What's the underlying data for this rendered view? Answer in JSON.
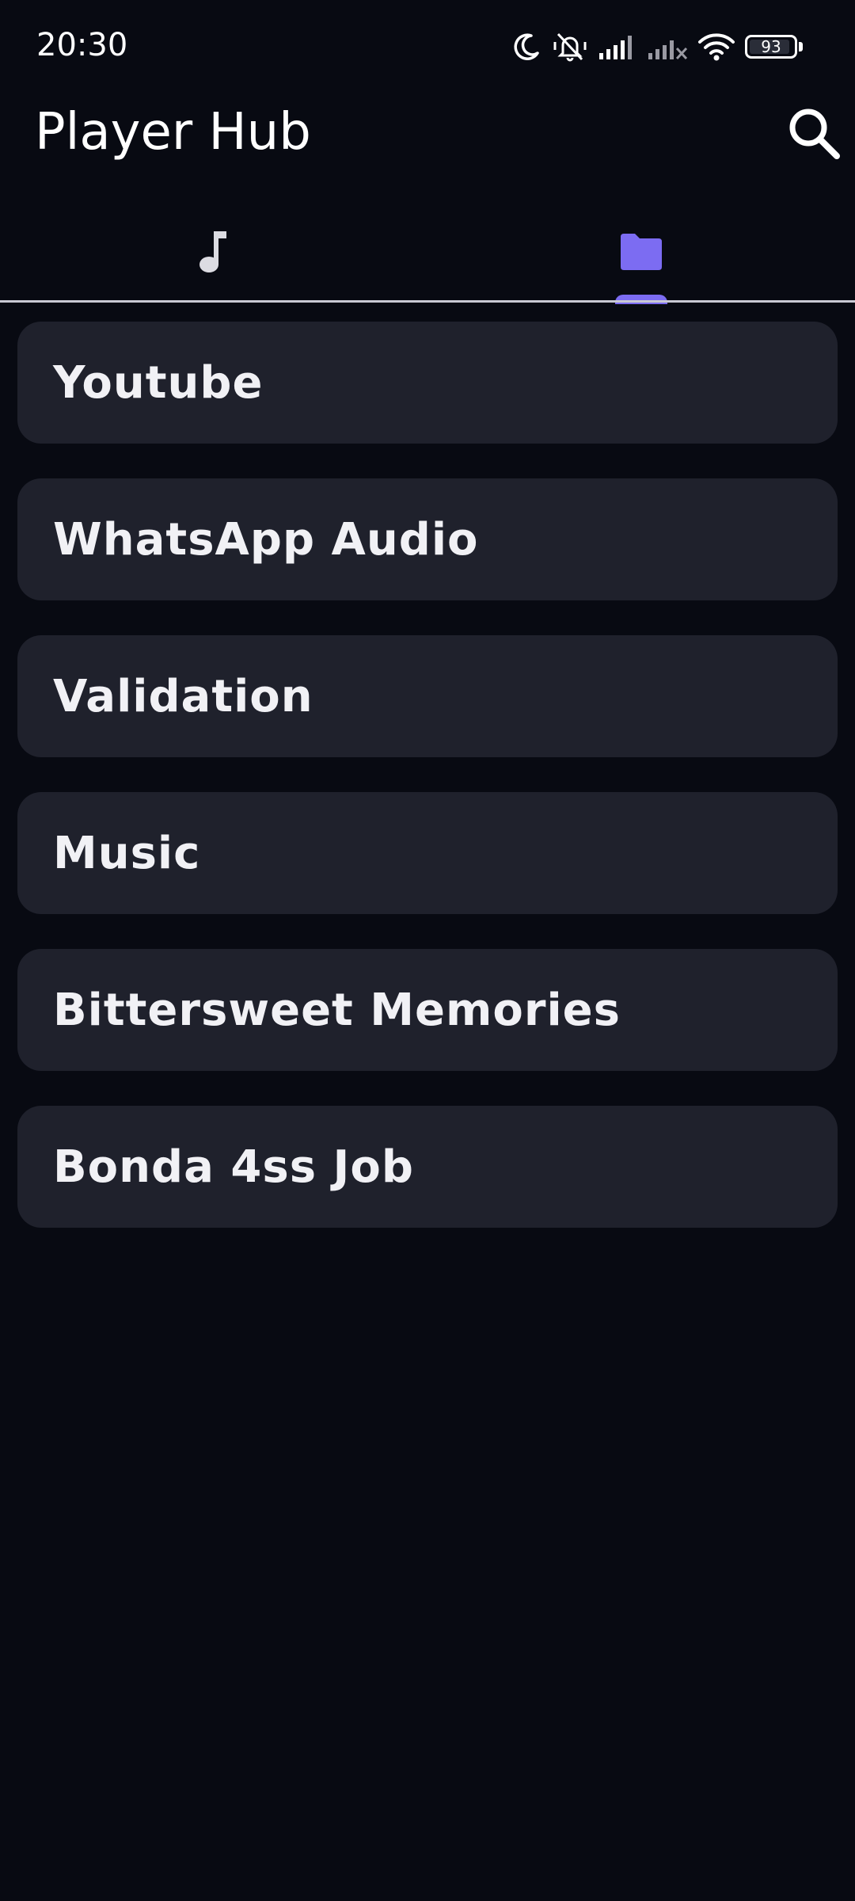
{
  "status_bar": {
    "time": "20:30",
    "battery_level": "93",
    "icons": [
      "moon-icon",
      "vibrate-off-icon",
      "signal-icon",
      "signal-no-service-icon",
      "wifi-icon",
      "battery-icon"
    ]
  },
  "app_bar": {
    "title": "Player Hub",
    "search_icon": "search-icon"
  },
  "tabs": [
    {
      "icon": "music-note-icon",
      "selected": false
    },
    {
      "icon": "folder-icon",
      "selected": true
    }
  ],
  "colors": {
    "background": "#080a12",
    "card": "#1f212c",
    "accent": "#7c6cf2",
    "text": "#ffffff"
  },
  "folders": [
    {
      "name": "Youtube"
    },
    {
      "name": "WhatsApp Audio"
    },
    {
      "name": "Validation"
    },
    {
      "name": "Music"
    },
    {
      "name": "Bittersweet Memories"
    },
    {
      "name": "Bonda 4ss Job"
    }
  ]
}
